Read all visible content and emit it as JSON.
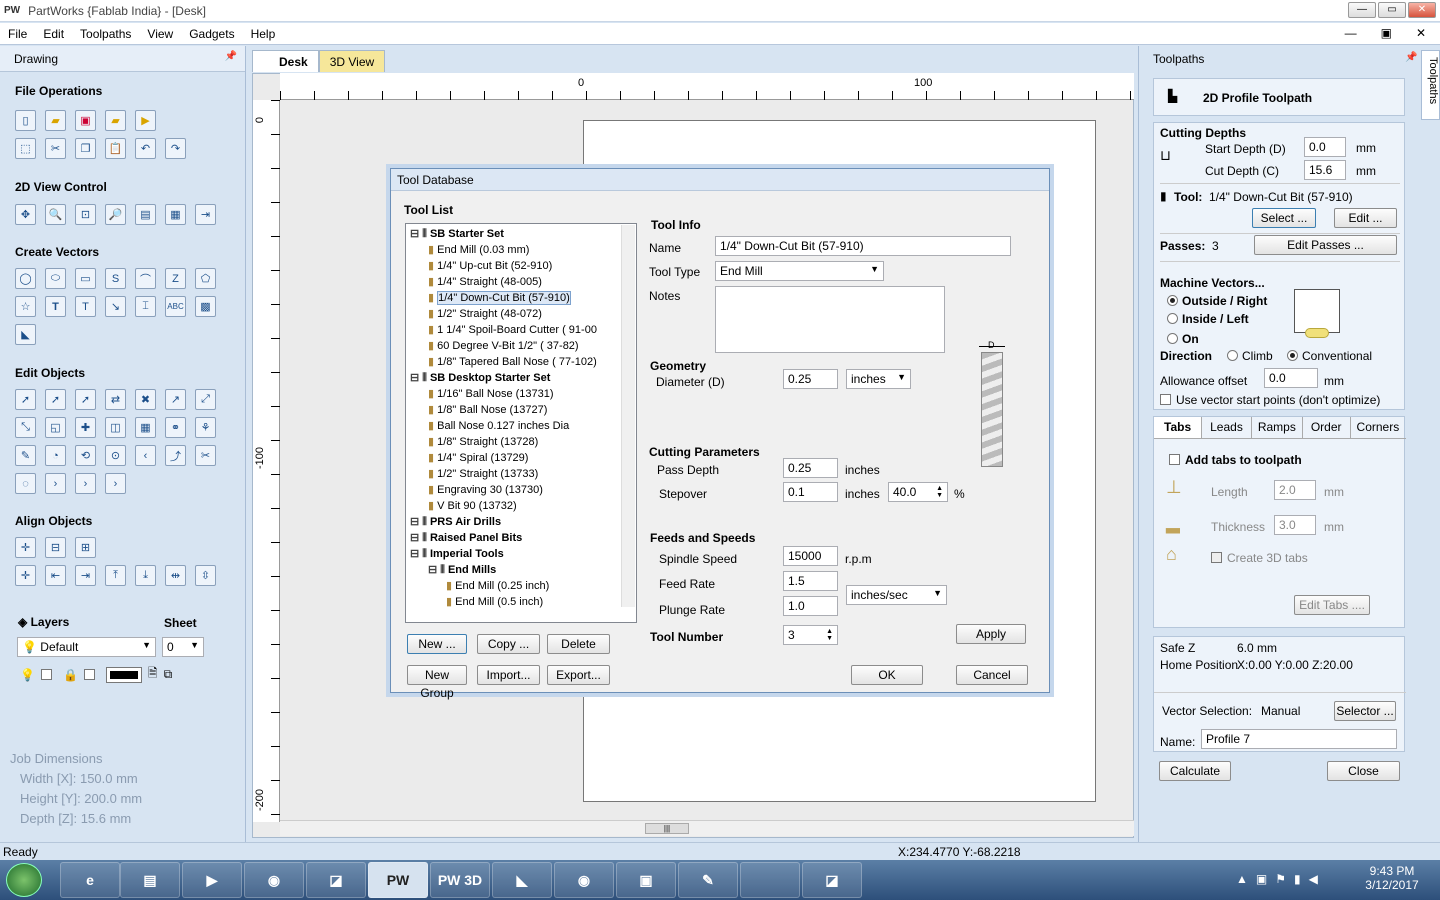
{
  "window": {
    "logo": "PW",
    "title": "PartWorks {Fablab India} - [Desk]",
    "btn_min": "—",
    "btn_max": "▭",
    "btn_close": "✕"
  },
  "menu": [
    "File",
    "Edit",
    "Toolpaths",
    "View",
    "Gadgets",
    "Help"
  ],
  "left": {
    "panel_title": "Drawing",
    "file_ops": "File Operations",
    "view_ctrl": "2D View Control",
    "create_vec": "Create Vectors",
    "edit_obj": "Edit Objects",
    "align_obj": "Align Objects",
    "layers": "Layers",
    "sheet": "Sheet",
    "layer_value": "Default",
    "sheet_value": "0",
    "job_title": "Job Dimensions",
    "job_width": "Width  [X]: 150.0 mm",
    "job_height": "Height [Y]: 200.0 mm",
    "job_depth": "Depth  [Z]: 15.6 mm"
  },
  "center": {
    "tab_desk": "Desk",
    "tab_3d": "3D View",
    "ruler_0": "0",
    "ruler_100": "100",
    "vruler_0": "0",
    "vruler_m100": "-100",
    "vruler_m200": "-200"
  },
  "dialog": {
    "title": "Tool Database",
    "tool_list": "Tool List",
    "tree": [
      {
        "t": "SB Starter Set",
        "g": true,
        "l": 0
      },
      {
        "t": "End Mill (0.03 mm)",
        "l": 1
      },
      {
        "t": "1/4\" Up-cut Bit (52-910)",
        "l": 1
      },
      {
        "t": "1/4\" Straight  (48-005)",
        "l": 1
      },
      {
        "t": "1/4\"  Down-Cut Bit (57-910)",
        "l": 1,
        "s": true
      },
      {
        "t": "1/2\" Straight  (48-072)",
        "l": 1
      },
      {
        "t": "1 1/4\" Spoil-Board Cutter  ( 91-00",
        "l": 1
      },
      {
        "t": "60 Degree V-Bit 1/2\"  ( 37-82)",
        "l": 1
      },
      {
        "t": "1/8\" Tapered Ball Nose  ( 77-102)",
        "l": 1
      },
      {
        "t": "SB Desktop Starter Set",
        "g": true,
        "l": 0
      },
      {
        "t": "1/16\" Ball Nose  (13731)",
        "l": 1
      },
      {
        "t": "1/8\" Ball Nose  (13727)",
        "l": 1
      },
      {
        "t": "Ball Nose 0.127 inches Dia",
        "l": 1
      },
      {
        "t": "1/8\" Straight  (13728)",
        "l": 1
      },
      {
        "t": "1/4\" Spiral  (13729)",
        "l": 1
      },
      {
        "t": "1/2\" Straight  (13733)",
        "l": 1
      },
      {
        "t": "Engraving 30  (13730)",
        "l": 1
      },
      {
        "t": "V Bit 90  (13732)",
        "l": 1
      },
      {
        "t": "PRS Air Drills",
        "g": true,
        "l": 0
      },
      {
        "t": "Raised Panel Bits",
        "g": true,
        "l": 0
      },
      {
        "t": "Imperial Tools",
        "g": true,
        "l": 0
      },
      {
        "t": "End Mills",
        "g": true,
        "l": 1
      },
      {
        "t": "End Mill (0.25 inch)",
        "l": 2
      },
      {
        "t": "End Mill (0.5 inch)",
        "l": 2
      }
    ],
    "btn_new": "New ...",
    "btn_copy": "Copy ...",
    "btn_delete": "Delete",
    "btn_newgroup": "New Group",
    "btn_import": "Import...",
    "btn_export": "Export...",
    "tool_info": "Tool Info",
    "name_lbl": "Name",
    "name_val": "1/4\"  Down-Cut Bit (57-910)",
    "type_lbl": "Tool Type",
    "type_val": "End Mill",
    "notes_lbl": "Notes",
    "geometry": "Geometry",
    "diameter_lbl": "Diameter (D)",
    "diameter_val": "0.25",
    "units_val": "inches",
    "cutting": "Cutting Parameters",
    "passdepth_lbl": "Pass Depth",
    "passdepth_val": "0.25",
    "passdepth_unit": "inches",
    "stepover_lbl": "Stepover",
    "stepover_val": "0.1",
    "stepover_unit": "inches",
    "stepover_pct": "40.0",
    "pct": "%",
    "feeds": "Feeds and Speeds",
    "spindle_lbl": "Spindle Speed",
    "spindle_val": "15000",
    "spindle_unit": "r.p.m",
    "feed_lbl": "Feed Rate",
    "feed_val": "1.5",
    "rate_unit": "inches/sec",
    "plunge_lbl": "Plunge Rate",
    "plunge_val": "1.0",
    "toolnum_lbl": "Tool Number",
    "toolnum_val": "3",
    "btn_apply": "Apply",
    "btn_ok": "OK",
    "btn_cancel": "Cancel",
    "diagram_label": "D"
  },
  "right": {
    "panel_title": "Toolpaths",
    "vtab": "Toolpaths",
    "header": "2D Profile Toolpath",
    "cutting_depths": "Cutting Depths",
    "start_lbl": "Start Depth (D)",
    "start_val": "0.0",
    "mm": "mm",
    "cut_lbl": "Cut Depth (C)",
    "cut_val": "15.6",
    "tool_lbl": "Tool:",
    "tool_val": "1/4\"  Down-Cut Bit (57-910)",
    "btn_select": "Select ...",
    "btn_edit": "Edit ...",
    "passes_lbl": "Passes:",
    "passes_val": "3",
    "btn_editpasses": "Edit Passes ...",
    "machine": "Machine Vectors...",
    "outside": "Outside / Right",
    "inside": "Inside / Left",
    "on": "On",
    "direction": "Direction",
    "climb": "Climb",
    "conventional": "Conventional",
    "allowance_lbl": "Allowance offset",
    "allowance_val": "0.0",
    "vecstart": "Use vector start points (don't optimize)",
    "tabs": [
      "Tabs",
      "Leads",
      "Ramps",
      "Order",
      "Corners"
    ],
    "addtabs": "Add tabs to toolpath",
    "length_lbl": "Length",
    "length_val": "2.0",
    "thick_lbl": "Thickness",
    "thick_val": "3.0",
    "create3d": "Create 3D tabs",
    "btn_edittabs": "Edit Tabs ....",
    "safez_lbl": "Safe Z",
    "safez_val": "6.0 mm",
    "home_lbl": "Home Position",
    "home_val": "X:0.00 Y:0.00 Z:20.00",
    "vecsel_lbl": "Vector Selection:",
    "vecsel_val": "Manual",
    "btn_selector": "Selector ...",
    "name_lbl": "Name:",
    "name_val": "Profile 7",
    "btn_calc": "Calculate",
    "btn_close": "Close"
  },
  "status": {
    "ready": "Ready",
    "coords": "X:234.4770 Y:-68.2218"
  },
  "taskbar": {
    "time": "9:43 PM",
    "date": "3/12/2017",
    "pw": "PW",
    "pw3d": "PW 3D"
  }
}
